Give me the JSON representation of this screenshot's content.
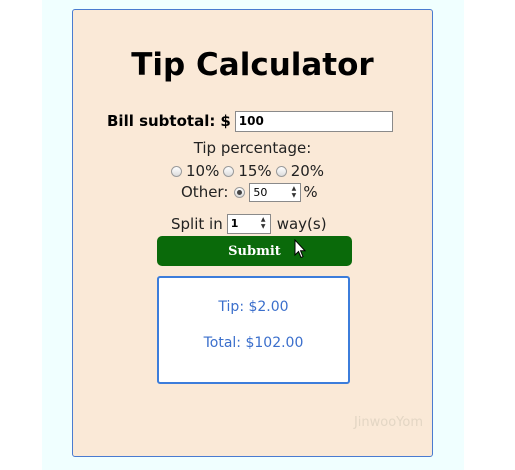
{
  "app": {
    "title": "Tip Calculator",
    "watermark": "JinwooYom"
  },
  "bill": {
    "label": "Bill subtotal:",
    "currency": "$",
    "value": "100"
  },
  "tip": {
    "label": "Tip percentage:",
    "options": [
      {
        "label": "10%",
        "selected": false
      },
      {
        "label": "15%",
        "selected": false
      },
      {
        "label": "20%",
        "selected": false
      }
    ],
    "other_label": "Other:",
    "other_selected": true,
    "other_value": "50",
    "other_suffix": "%"
  },
  "split": {
    "label": "Split in",
    "value": "1",
    "suffix": "way(s)"
  },
  "submit_label": "Submit",
  "result": {
    "tip": "Tip: $2.00",
    "total": "Total: $102.00"
  },
  "colors": {
    "card_bg": "#fae9d7",
    "submit_bg": "#0a6a0a",
    "result_text": "#3b6fcc",
    "accent_border": "#3c7ddb"
  }
}
